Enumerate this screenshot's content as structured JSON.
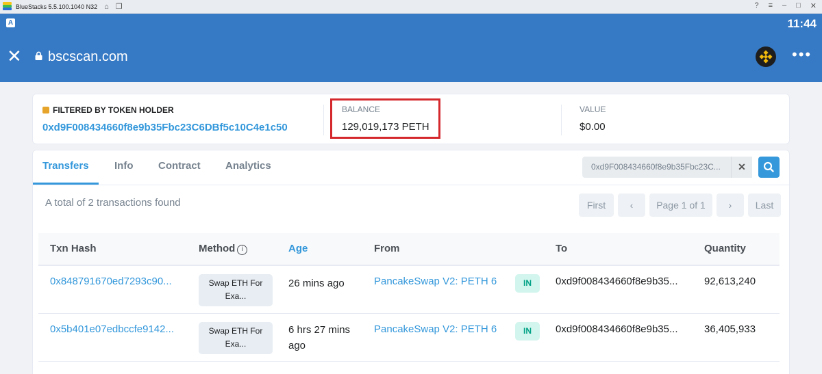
{
  "emulator": {
    "title": "BlueStacks 5.5.100.1040 N32"
  },
  "status_bar": {
    "time": "11:44"
  },
  "browser": {
    "url": "bscscan.com"
  },
  "holder": {
    "label": "FILTERED BY TOKEN HOLDER",
    "address": "0xd9F008434660f8e9b35Fbc23C6DBf5c10C4e1c50"
  },
  "balance": {
    "label": "BALANCE",
    "value": "129,019,173 PETH"
  },
  "value": {
    "label": "VALUE",
    "value": "$0.00"
  },
  "tabs": [
    {
      "label": "Transfers",
      "active": true
    },
    {
      "label": "Info",
      "active": false
    },
    {
      "label": "Contract",
      "active": false
    },
    {
      "label": "Analytics",
      "active": false
    }
  ],
  "search": {
    "value": "0xd9F008434660f8e9b35Fbc23C..."
  },
  "summary": "A total of 2 transactions found",
  "pagination": {
    "first": "First",
    "page": "Page 1 of 1",
    "last": "Last"
  },
  "table": {
    "headers": {
      "txn_hash": "Txn Hash",
      "method": "Method",
      "age": "Age",
      "from": "From",
      "to": "To",
      "quantity": "Quantity"
    },
    "rows": [
      {
        "txn_hash": "0x848791670ed7293c90...",
        "method_line1": "Swap ETH For",
        "method_line2": "Exa...",
        "age_line1": "26 mins ago",
        "age_line2": "",
        "from": "PancakeSwap V2: PETH 6",
        "direction": "IN",
        "to": "0xd9f008434660f8e9b35...",
        "quantity": "92,613,240"
      },
      {
        "txn_hash": "0x5b401e07edbccfe9142...",
        "method_line1": "Swap ETH For",
        "method_line2": "Exa...",
        "age_line1": "6 hrs 27 mins",
        "age_line2": "ago",
        "from": "PancakeSwap V2: PETH 6",
        "direction": "IN",
        "to": "0xd9f008434660f8e9b35...",
        "quantity": "36,405,933"
      }
    ]
  },
  "colors": {
    "header_blue": "#3679c4",
    "link_blue": "#3498db",
    "highlight_red": "#d4282d",
    "in_badge_green": "#00a186"
  }
}
